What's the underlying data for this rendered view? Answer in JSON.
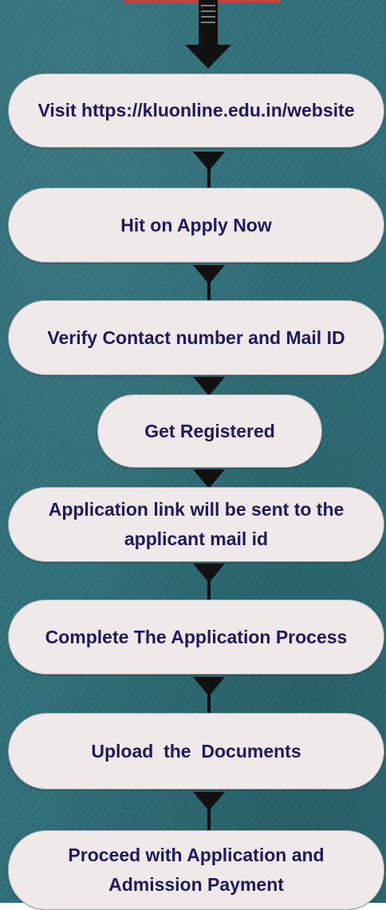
{
  "flowchart": {
    "steps": [
      {
        "label": "Visit https://kluonline.edu.in/website"
      },
      {
        "label": "Hit on Apply Now"
      },
      {
        "label": "Verify Contact number and Mail ID"
      },
      {
        "label": "Get Registered"
      },
      {
        "label": "Application link will be sent to the applicant mail id"
      },
      {
        "label": "Complete The Application Process"
      },
      {
        "label": "Upload  the  Documents"
      },
      {
        "label": "Proceed with Application and Admission Payment"
      }
    ]
  },
  "colors": {
    "background": "#2d6f79",
    "box_fill": "#efe9ea",
    "text": "#1e1a5e",
    "arrow": "#111111",
    "top_accent": "#c8443a"
  }
}
